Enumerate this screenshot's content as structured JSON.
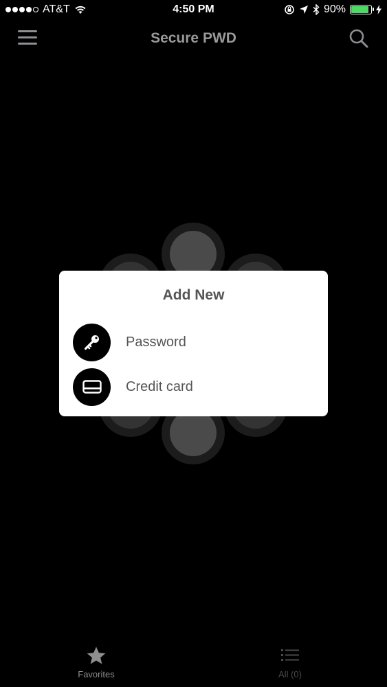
{
  "status_bar": {
    "carrier": "AT&T",
    "time": "4:50 PM",
    "battery": "90%",
    "battery_level": 0.9,
    "icons": [
      "signal-dots-icon",
      "wifi-icon",
      "orientation-lock-icon",
      "location-arrow-icon",
      "bluetooth-icon",
      "battery-icon",
      "charging-bolt-icon"
    ]
  },
  "nav": {
    "title": "Secure PWD",
    "menu_icon": "hamburger-menu-icon",
    "search_icon": "search-icon"
  },
  "modal": {
    "title": "Add New",
    "options": [
      {
        "label": "Password",
        "icon": "key-icon"
      },
      {
        "label": "Credit card",
        "icon": "credit-card-icon"
      }
    ]
  },
  "tabs": [
    {
      "label": "Favorites",
      "icon": "star-icon"
    },
    {
      "label": "All (0)",
      "icon": "list-icon"
    }
  ],
  "colors": {
    "background": "#000000",
    "modal_bg": "#ffffff",
    "battery_green": "#4cd964",
    "muted_gray": "#8e8e93"
  }
}
